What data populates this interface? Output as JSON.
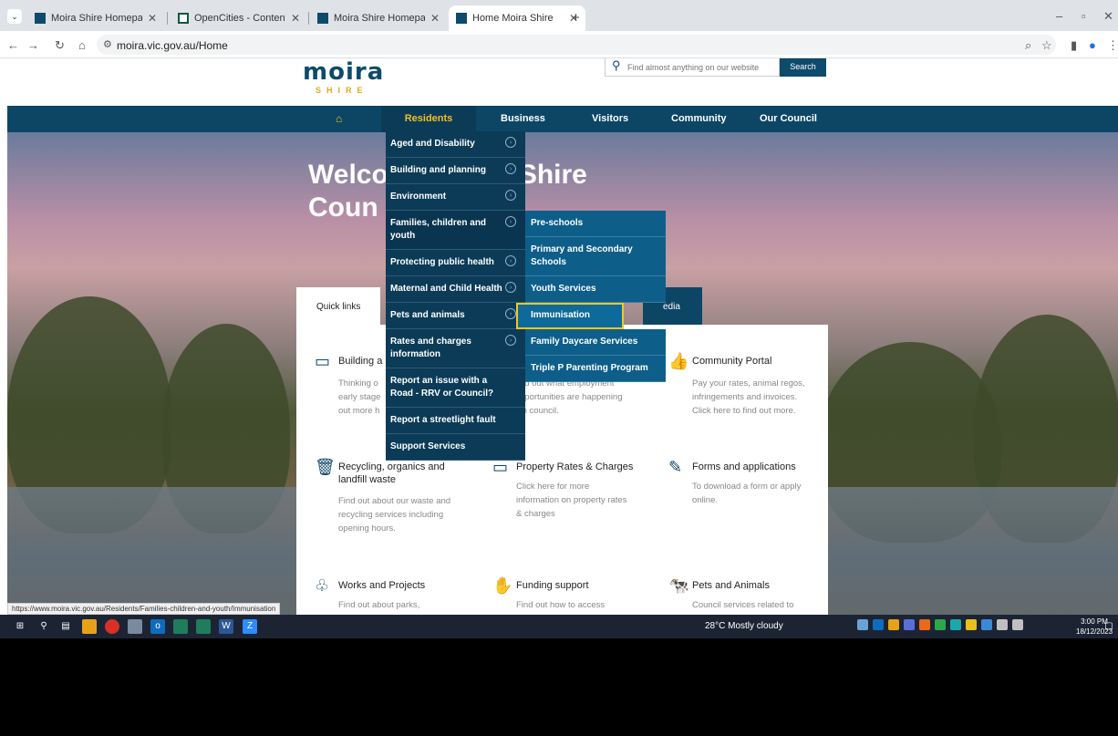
{
  "browser": {
    "tabs": [
      {
        "title": "Moira Shire Homepage",
        "active": false
      },
      {
        "title": "OpenCities - Content Managem",
        "active": false
      },
      {
        "title": "Moira Shire Homepage",
        "active": false
      },
      {
        "title": "Home Moira Shire",
        "active": true
      }
    ],
    "url": "moira.vic.gov.au/Home",
    "status_url": "https://www.moira.vic.gov.au/Residents/Families-children-and-youth/Immunisation"
  },
  "site": {
    "logo_name": "moira",
    "logo_sub": "SHIRE",
    "search_placeholder": "Find almost anything on our website",
    "search_button": "Search",
    "nav": {
      "home_icon": "home-icon",
      "items": [
        "Residents",
        "Business",
        "Visitors",
        "Community",
        "Our Council"
      ]
    },
    "welcome_line1": "Welco",
    "welcome_line1b": "ira Shire",
    "welcome_line2": "Coun",
    "quick_links_tab": "Quick links",
    "media_tab": "edia"
  },
  "dropdown_residents": [
    "Aged and Disability",
    "Building and planning",
    "Environment",
    "Families, children and youth",
    "Protecting public health",
    "Maternal and Child Health",
    "Pets and animals",
    "Rates and charges information",
    "Report an issue with a Road - RRV or Council?",
    "Report a streetlight fault",
    "Support Services"
  ],
  "dropdown_families": [
    "Pre-schools",
    "Primary and Secondary Schools",
    "Youth Services",
    "Immunisation",
    "Family Daycare Services",
    "Triple P Parenting Program"
  ],
  "cards": {
    "building_title": "Building a",
    "building_desc": "Thinking o\nearly stage\nout more h",
    "employment_desc": "nd out what employment\npportunities are happening\nth council.",
    "portal_title": "Community Portal",
    "portal_desc": "Pay your rates, animal regos,\ninfringements and invoices.\nClick here to find out more.",
    "recycling_title": "Recycling, organics and\nlandfill waste",
    "recycling_desc": "Find out about our waste and\nrecycling services including\nopening hours.",
    "rates_title": "Property Rates & Charges",
    "rates_desc": "Click here for more\ninformation on property rates\n& charges",
    "forms_title": "Forms and applications",
    "forms_desc": "To download a form or apply\nonline.",
    "works_title": "Works and Projects",
    "works_desc": "Find out about parks,",
    "funding_title": "Funding support",
    "funding_desc": "Find out how to access",
    "pets_title": "Pets and Animals",
    "pets_desc": "Council services related to"
  },
  "taskbar": {
    "weather": "28°C  Mostly cloudy",
    "time": "3:00 PM",
    "date": "18/12/2023"
  }
}
